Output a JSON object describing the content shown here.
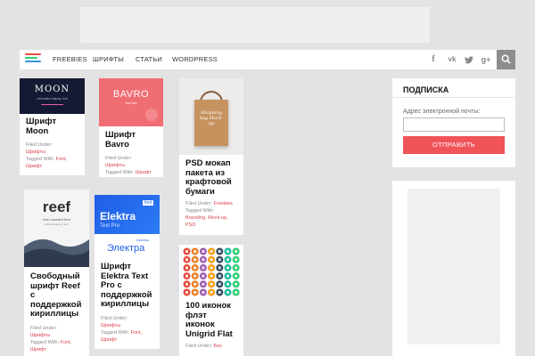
{
  "nav": {
    "items": [
      {
        "label": "FREEBIES"
      },
      {
        "label": "ШРИФТЫ"
      },
      {
        "label": "СТАТЬИ"
      },
      {
        "label": "WORDPRESS"
      }
    ],
    "social": [
      {
        "icon": "facebook-icon",
        "glyph": "f"
      },
      {
        "icon": "vk-icon",
        "glyph": "vk"
      },
      {
        "icon": "twitter-icon",
        "glyph": "t"
      },
      {
        "icon": "google-plus-icon",
        "glyph": "g+"
      }
    ],
    "search_icon": "search-icon",
    "logo_colors": [
      "#e74c3c",
      "#2ecc71",
      "#3498db",
      "#f1c40f"
    ]
  },
  "cards": {
    "moon": {
      "thumb_text": "MOON",
      "thumb_sub": "minimalist display font",
      "title": "Шрифт Moon",
      "filed_label": "Filed Under:",
      "filed_link": "Шрифты",
      "tagged_label": "Tagged With:",
      "tags": "Font,",
      "tags2": "Шрифт"
    },
    "bavro": {
      "thumb_text": "BAVRO",
      "thumb_sub": "free font",
      "title": "Шрифт Bavro",
      "filed_label": "Filed Under:",
      "filed_link": "Шрифты",
      "tagged_label": "Tagged With:",
      "tags": "Шрифт"
    },
    "psd": {
      "thumb_text": "Shopping bag Mock-up",
      "title": "PSD мокап пакета из крафтовой бумаги",
      "filed_label": "Filed Under:",
      "filed_link": "Freebies",
      "tagged_label": "Tagged With:",
      "tags": "Branding, Mock-up,",
      "tags2": "PSD"
    },
    "reef": {
      "thumb_text": "reef",
      "thumb_sub": "free rounded font",
      "thumb_sub2": "with cleaned up font",
      "title": "Свободный шрифт Reef с поддержкой кириллицы",
      "filed_label": "Filed Under:",
      "filed_link": "Шрифты",
      "tagged_label": "Tagged With:",
      "tags": "Font,",
      "tags2": "Шрифт"
    },
    "elektra": {
      "thumb_text": "Elektra",
      "thumb_badge": "font",
      "thumb_sub": "Text Pro",
      "thumb_text2": "Электра",
      "thumb_sub2": "гротеск",
      "title": "Шрифт Elektra Text Pro с поддержкой кириллицы",
      "filed_label": "Filed Under:",
      "filed_link": "Шрифты",
      "tagged_label": "Tagged With:",
      "tags": "Font,",
      "tags2": "Шрифт"
    },
    "icons": {
      "title": "100 иконок флэт иконок Unigrid Flat",
      "filed_label": "Filed Under:",
      "filed_link": "Без"
    }
  },
  "subscribe": {
    "title": "ПОДПИСКА",
    "label": "Адрес электронной почты:",
    "button": "ОТПРАВИТЬ"
  },
  "colors": {
    "accent": "#f05358",
    "link": "#d9454d",
    "page_bg": "#e3e3e3"
  }
}
